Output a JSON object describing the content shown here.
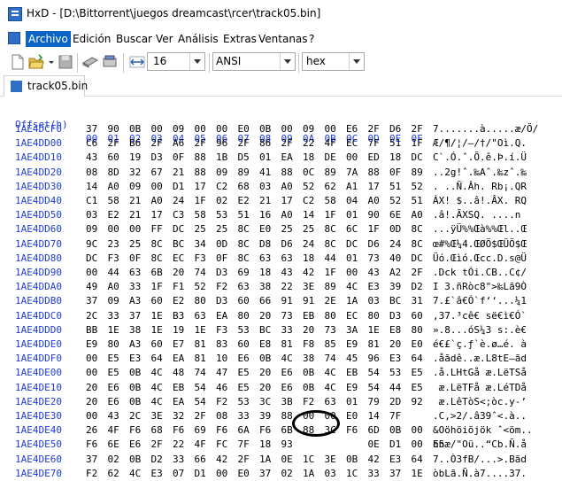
{
  "window": {
    "title": "HxD - [D:\\Bittorrent\\juegos dreamcast\\rcer\\track05.bin]"
  },
  "menu": {
    "items": [
      "Archivo",
      "Edición",
      "Buscar",
      "Ver",
      "Análisis",
      "Extras",
      "Ventanas",
      "?"
    ]
  },
  "toolbar": {
    "bytes_per_row": "16",
    "charset": "ANSI",
    "offset_base": "hex"
  },
  "tabs": [
    {
      "label": "track05.bin"
    }
  ],
  "hex_header": {
    "offset_label": "Offset(h)",
    "columns": [
      "00",
      "01",
      "02",
      "03",
      "04",
      "05",
      "06",
      "07",
      "08",
      "09",
      "0A",
      "0B",
      "0C",
      "0D",
      "0E",
      "0F"
    ]
  },
  "rows": [
    {
      "offset": "1AE4DCF0",
      "bytes": [
        "37",
        "90",
        "0B",
        "00",
        "09",
        "00",
        "00",
        "E0",
        "0B",
        "00",
        "09",
        "00",
        "E6",
        "2F",
        "D6",
        "2F"
      ],
      "text": "7.......à.....æ/Ö/"
    },
    {
      "offset": "1AE4DD00",
      "bytes": [
        "C6",
        "2F",
        "B6",
        "2F",
        "A6",
        "2F",
        "96",
        "2F",
        "86",
        "2F",
        "22",
        "4F",
        "EC",
        "7F",
        "51",
        "1F"
      ],
      "text": "Æ/¶/¦/–/†/\"Oì.Q."
    },
    {
      "offset": "1AE4DD10",
      "bytes": [
        "43",
        "60",
        "19",
        "D3",
        "0F",
        "88",
        "1B",
        "D5",
        "01",
        "EA",
        "18",
        "DE",
        "00",
        "ED",
        "18",
        "DC"
      ],
      "text": "C`.Ó.ˆ.Õ.ê.Þ.í.Ü"
    },
    {
      "offset": "1AE4DD20",
      "bytes": [
        "08",
        "8D",
        "32",
        "67",
        "21",
        "88",
        "09",
        "89",
        "41",
        "88",
        "0C",
        "89",
        "7A",
        "88",
        "0F",
        "89"
      ],
      "text": "..2g!ˆ.‰Aˆ.‰zˆ.‰"
    },
    {
      "offset": "1AE4DD30",
      "bytes": [
        "14",
        "A0",
        "09",
        "00",
        "D1",
        "17",
        "C2",
        "68",
        "03",
        "A0",
        "52",
        "62",
        "A1",
        "17",
        "51",
        "52"
      ],
      "text": ". ..Ñ.Âh. Rb¡.QR"
    },
    {
      "offset": "1AE4DD40",
      "bytes": [
        "C1",
        "58",
        "21",
        "A0",
        "24",
        "1F",
        "02",
        "E2",
        "21",
        "17",
        "C2",
        "58",
        "04",
        "A0",
        "52",
        "51"
      ],
      "text": "ÁX! $..â!.ÂX. RQ"
    },
    {
      "offset": "1AE4DD50",
      "bytes": [
        "03",
        "E2",
        "21",
        "17",
        "C3",
        "58",
        "53",
        "51",
        "16",
        "A0",
        "14",
        "1F",
        "01",
        "90",
        "6E",
        "A0"
      ],
      "text": ".â!.ÃXSQ. ....n "
    },
    {
      "offset": "1AE4DD60",
      "bytes": [
        "09",
        "00",
        "00",
        "FF",
        "DC",
        "25",
        "25",
        "8C",
        "E0",
        "25",
        "25",
        "8C",
        "6C",
        "1F",
        "0D",
        "8C"
      ],
      "text": "...ÿÜ%%Œà%%Œl..Œ"
    },
    {
      "offset": "1AE4DD70",
      "bytes": [
        "9C",
        "23",
        "25",
        "8C",
        "BC",
        "34",
        "0D",
        "8C",
        "D8",
        "D6",
        "24",
        "8C",
        "DC",
        "D6",
        "24",
        "8C"
      ],
      "text": "œ#%Œ¼4.ŒØÖ$ŒÜÖ$Œ"
    },
    {
      "offset": "1AE4DD80",
      "bytes": [
        "DC",
        "F3",
        "0F",
        "8C",
        "EC",
        "F3",
        "0F",
        "8C",
        "63",
        "63",
        "18",
        "44",
        "01",
        "73",
        "40",
        "DC"
      ],
      "text": "Üó.Œìó.Œcc.D.s@Ü"
    },
    {
      "offset": "1AE4DD90",
      "bytes": [
        "00",
        "44",
        "63",
        "6B",
        "20",
        "74",
        "D3",
        "69",
        "18",
        "43",
        "42",
        "1F",
        "00",
        "43",
        "A2",
        "2F"
      ],
      "text": ".Dck tÓi.CB..C¢/"
    },
    {
      "offset": "1AE4DDA0",
      "bytes": [
        "49",
        "A0",
        "33",
        "1F",
        "F1",
        "52",
        "F2",
        "63",
        "38",
        "22",
        "3E",
        "89",
        "4C",
        "E3",
        "39",
        "D2"
      ],
      "text": "I 3.ñRòc8\">‰Lã9Ò"
    },
    {
      "offset": "1AE4DDB0",
      "bytes": [
        "37",
        "09",
        "A3",
        "60",
        "E2",
        "80",
        "D3",
        "60",
        "66",
        "91",
        "91",
        "2E",
        "1A",
        "03",
        "BC",
        "31"
      ],
      "text": "7.£`â€Ó`f‘‘...¼1"
    },
    {
      "offset": "1AE4DDC0",
      "bytes": [
        "2C",
        "33",
        "37",
        "1E",
        "B3",
        "63",
        "EA",
        "80",
        "20",
        "73",
        "EB",
        "80",
        "EC",
        "80",
        "D3",
        "60"
      ],
      "text": ",37.³cê€ së€ì€Ó`"
    },
    {
      "offset": "1AE4DDD0",
      "bytes": [
        "BB",
        "1E",
        "38",
        "1E",
        "19",
        "1E",
        "F3",
        "53",
        "BC",
        "33",
        "20",
        "73",
        "3A",
        "1E",
        "E8",
        "80"
      ],
      "text": "».8...óS¼3 s:.è€"
    },
    {
      "offset": "1AE4DDE0",
      "bytes": [
        "E9",
        "80",
        "A3",
        "60",
        "E7",
        "81",
        "83",
        "60",
        "E8",
        "81",
        "F8",
        "85",
        "E9",
        "81",
        "20",
        "E0"
      ],
      "text": "é€£`ç.ƒ`è.ø…é. à"
    },
    {
      "offset": "1AE4DDF0",
      "bytes": [
        "00",
        "E5",
        "E3",
        "64",
        "EA",
        "81",
        "10",
        "E6",
        "0B",
        "4C",
        "38",
        "74",
        "45",
        "96",
        "E3",
        "64"
      ],
      "text": ".åãdê..æ.L8tE–ãd"
    },
    {
      "offset": "1AE4DE00",
      "bytes": [
        "00",
        "E5",
        "0B",
        "4C",
        "48",
        "74",
        "47",
        "E5",
        "20",
        "E6",
        "0B",
        "4C",
        "EB",
        "54",
        "53",
        "E5"
      ],
      "text": ".å.LHtGå æ.LëTSå"
    },
    {
      "offset": "1AE4DE10",
      "bytes": [
        "20",
        "E6",
        "0B",
        "4C",
        "EB",
        "54",
        "46",
        "E5",
        "20",
        "E6",
        "0B",
        "4C",
        "E9",
        "54",
        "44",
        "E5"
      ],
      "text": " æ.LëTFå æ.LéTDå"
    },
    {
      "offset": "1AE4DE20",
      "bytes": [
        "20",
        "E6",
        "0B",
        "4C",
        "EA",
        "54",
        "F2",
        "53",
        "3C",
        "3B",
        "F2",
        "63",
        "01",
        "79",
        "2D",
        "92"
      ],
      "text": " æ.LêTòS<;òc.y-’"
    },
    {
      "offset": "1AE4DE30",
      "bytes": [
        "00",
        "43",
        "2C",
        "3E",
        "32",
        "2F",
        "08",
        "33",
        "39",
        "88",
        "00",
        "00",
        "E0",
        "14",
        "7F"
      ],
      "text": ".C,>2/.â39ˆ<.à.."
    },
    {
      "offset": "1AE4DE40",
      "bytes": [
        "26",
        "4F",
        "F6",
        "68",
        "F6",
        "69",
        "F6",
        "6A",
        "F6",
        "6B",
        "88",
        "3C",
        "F6",
        "6D",
        "0B",
        "00"
      ],
      "text": "&Oöhöiöjök ˆ<öm.."
    },
    {
      "offset": "1AE4DE50",
      "bytes": [
        "F6",
        "6E",
        "E6",
        "2F",
        "22",
        "4F",
        "FC",
        "7F",
        "18",
        "93",
        "",
        "",
        "",
        "0E",
        "D1",
        "00",
        "E5"
      ],
      "text": "önæ/\"Oü..“Cb.Ñ.å"
    },
    {
      "offset": "1AE4DE60",
      "bytes": [
        "37",
        "02",
        "0B",
        "D2",
        "33",
        "66",
        "42",
        "2F",
        "1A",
        "0E",
        "1C",
        "3E",
        "0B",
        "42",
        "E3",
        "64"
      ],
      "text": "7..Ò3fB/...>.Bãd"
    },
    {
      "offset": "1AE4DE70",
      "bytes": [
        "F2",
        "62",
        "4C",
        "E3",
        "07",
        "D1",
        "00",
        "E0",
        "37",
        "02",
        "1A",
        "03",
        "1C",
        "33",
        "37",
        "1E"
      ],
      "text": "òbLã.Ñ.à7....37."
    }
  ]
}
